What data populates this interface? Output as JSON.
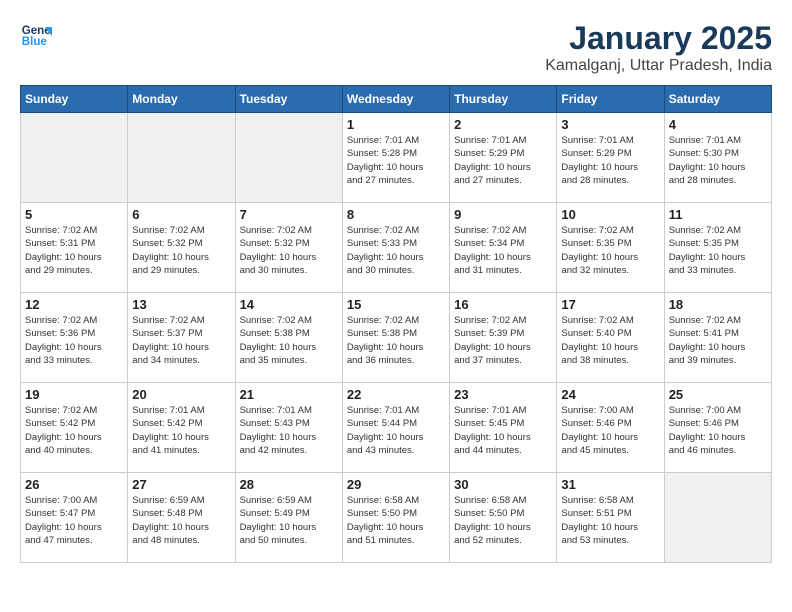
{
  "header": {
    "logo_line1": "General",
    "logo_line2": "Blue",
    "title": "January 2025",
    "subtitle": "Kamalganj, Uttar Pradesh, India"
  },
  "weekdays": [
    "Sunday",
    "Monday",
    "Tuesday",
    "Wednesday",
    "Thursday",
    "Friday",
    "Saturday"
  ],
  "weeks": [
    [
      {
        "day": "",
        "info": ""
      },
      {
        "day": "",
        "info": ""
      },
      {
        "day": "",
        "info": ""
      },
      {
        "day": "1",
        "info": "Sunrise: 7:01 AM\nSunset: 5:28 PM\nDaylight: 10 hours\nand 27 minutes."
      },
      {
        "day": "2",
        "info": "Sunrise: 7:01 AM\nSunset: 5:29 PM\nDaylight: 10 hours\nand 27 minutes."
      },
      {
        "day": "3",
        "info": "Sunrise: 7:01 AM\nSunset: 5:29 PM\nDaylight: 10 hours\nand 28 minutes."
      },
      {
        "day": "4",
        "info": "Sunrise: 7:01 AM\nSunset: 5:30 PM\nDaylight: 10 hours\nand 28 minutes."
      }
    ],
    [
      {
        "day": "5",
        "info": "Sunrise: 7:02 AM\nSunset: 5:31 PM\nDaylight: 10 hours\nand 29 minutes."
      },
      {
        "day": "6",
        "info": "Sunrise: 7:02 AM\nSunset: 5:32 PM\nDaylight: 10 hours\nand 29 minutes."
      },
      {
        "day": "7",
        "info": "Sunrise: 7:02 AM\nSunset: 5:32 PM\nDaylight: 10 hours\nand 30 minutes."
      },
      {
        "day": "8",
        "info": "Sunrise: 7:02 AM\nSunset: 5:33 PM\nDaylight: 10 hours\nand 30 minutes."
      },
      {
        "day": "9",
        "info": "Sunrise: 7:02 AM\nSunset: 5:34 PM\nDaylight: 10 hours\nand 31 minutes."
      },
      {
        "day": "10",
        "info": "Sunrise: 7:02 AM\nSunset: 5:35 PM\nDaylight: 10 hours\nand 32 minutes."
      },
      {
        "day": "11",
        "info": "Sunrise: 7:02 AM\nSunset: 5:35 PM\nDaylight: 10 hours\nand 33 minutes."
      }
    ],
    [
      {
        "day": "12",
        "info": "Sunrise: 7:02 AM\nSunset: 5:36 PM\nDaylight: 10 hours\nand 33 minutes."
      },
      {
        "day": "13",
        "info": "Sunrise: 7:02 AM\nSunset: 5:37 PM\nDaylight: 10 hours\nand 34 minutes."
      },
      {
        "day": "14",
        "info": "Sunrise: 7:02 AM\nSunset: 5:38 PM\nDaylight: 10 hours\nand 35 minutes."
      },
      {
        "day": "15",
        "info": "Sunrise: 7:02 AM\nSunset: 5:38 PM\nDaylight: 10 hours\nand 36 minutes."
      },
      {
        "day": "16",
        "info": "Sunrise: 7:02 AM\nSunset: 5:39 PM\nDaylight: 10 hours\nand 37 minutes."
      },
      {
        "day": "17",
        "info": "Sunrise: 7:02 AM\nSunset: 5:40 PM\nDaylight: 10 hours\nand 38 minutes."
      },
      {
        "day": "18",
        "info": "Sunrise: 7:02 AM\nSunset: 5:41 PM\nDaylight: 10 hours\nand 39 minutes."
      }
    ],
    [
      {
        "day": "19",
        "info": "Sunrise: 7:02 AM\nSunset: 5:42 PM\nDaylight: 10 hours\nand 40 minutes."
      },
      {
        "day": "20",
        "info": "Sunrise: 7:01 AM\nSunset: 5:42 PM\nDaylight: 10 hours\nand 41 minutes."
      },
      {
        "day": "21",
        "info": "Sunrise: 7:01 AM\nSunset: 5:43 PM\nDaylight: 10 hours\nand 42 minutes."
      },
      {
        "day": "22",
        "info": "Sunrise: 7:01 AM\nSunset: 5:44 PM\nDaylight: 10 hours\nand 43 minutes."
      },
      {
        "day": "23",
        "info": "Sunrise: 7:01 AM\nSunset: 5:45 PM\nDaylight: 10 hours\nand 44 minutes."
      },
      {
        "day": "24",
        "info": "Sunrise: 7:00 AM\nSunset: 5:46 PM\nDaylight: 10 hours\nand 45 minutes."
      },
      {
        "day": "25",
        "info": "Sunrise: 7:00 AM\nSunset: 5:46 PM\nDaylight: 10 hours\nand 46 minutes."
      }
    ],
    [
      {
        "day": "26",
        "info": "Sunrise: 7:00 AM\nSunset: 5:47 PM\nDaylight: 10 hours\nand 47 minutes."
      },
      {
        "day": "27",
        "info": "Sunrise: 6:59 AM\nSunset: 5:48 PM\nDaylight: 10 hours\nand 48 minutes."
      },
      {
        "day": "28",
        "info": "Sunrise: 6:59 AM\nSunset: 5:49 PM\nDaylight: 10 hours\nand 50 minutes."
      },
      {
        "day": "29",
        "info": "Sunrise: 6:58 AM\nSunset: 5:50 PM\nDaylight: 10 hours\nand 51 minutes."
      },
      {
        "day": "30",
        "info": "Sunrise: 6:58 AM\nSunset: 5:50 PM\nDaylight: 10 hours\nand 52 minutes."
      },
      {
        "day": "31",
        "info": "Sunrise: 6:58 AM\nSunset: 5:51 PM\nDaylight: 10 hours\nand 53 minutes."
      },
      {
        "day": "",
        "info": ""
      }
    ]
  ]
}
